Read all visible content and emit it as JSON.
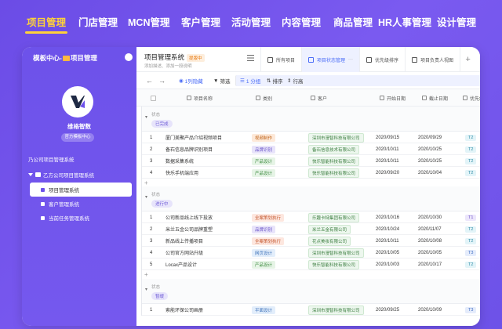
{
  "topnav": {
    "items": [
      "项目管理",
      "门店管理",
      "MCN管理",
      "客户管理",
      "活动管理",
      "内容管理",
      "商品管理",
      "HR人事管理",
      "设计管理"
    ],
    "active_index": 0,
    "active_color": "#ffd23a"
  },
  "left": {
    "title_prefix": "模板中心-",
    "title_suffix": "项目管理",
    "brand_name": "维格智数",
    "brand_sub": "官方模板中心",
    "tree_root": "乃公司项目管理系统",
    "tree_node": "乙方公司项目管理系统",
    "leaves": [
      "项目管理系统",
      "客户管理系统",
      "当前任务管理系统"
    ],
    "active_leaf": 0
  },
  "app": {
    "title": "项目管理系统",
    "badge": "提版中",
    "desc": "添加描述、添加一段说明",
    "tabs": [
      {
        "label": "所有项目",
        "active": false
      },
      {
        "label": "项目状态管理",
        "active": true,
        "more": "···"
      },
      {
        "label": "优先级排序",
        "active": false
      },
      {
        "label": "项目负责人视图",
        "active": false
      }
    ],
    "add_tab": "+"
  },
  "toolbar": {
    "undo": "←",
    "redo": "→",
    "hidden": "1列隐藏",
    "filter": "筛选",
    "group": "1 分组",
    "sort": "排序",
    "row_height": "行高"
  },
  "columns": [
    "项目名称",
    "类别",
    "客户",
    "开始日期",
    "截止日期",
    "优先级"
  ],
  "groups": [
    {
      "label": "状态",
      "tag": "已完成",
      "rows": [
        {
          "n": "1",
          "name": "厦门美聚产品介绍视频项目",
          "cat": "视频制作",
          "cat_color": "#fde9d9",
          "cat_text": "#c0651c",
          "cust": "深圳市漫智科技有限公司",
          "start": "2020/09/15",
          "end": "2020/09/29",
          "pri": "T2"
        },
        {
          "n": "2",
          "name": "备石信息品牌识别项目",
          "cat": "品牌识别",
          "cat_color": "#e8e4fa",
          "cat_text": "#6a55c9",
          "cust": "备石信息技术有限公司",
          "start": "2020/10/11",
          "end": "2020/10/25",
          "pri": "T2"
        },
        {
          "n": "3",
          "name": "数据采集系统",
          "cat": "产品设计",
          "cat_color": "#e6f4e6",
          "cat_text": "#3d8a3f",
          "cust": "快乐智能科技有限公司",
          "start": "2020/10/11",
          "end": "2020/10/25",
          "pri": "T2"
        },
        {
          "n": "4",
          "name": "快乐手机端应用",
          "cat": "产品设计",
          "cat_color": "#e6f4e6",
          "cat_text": "#3d8a3f",
          "cust": "快乐智能科技有限公司",
          "start": "2020/09/20",
          "end": "2020/10/04",
          "pri": "T2"
        }
      ]
    },
    {
      "label": "状态",
      "tag": "进行中",
      "rows": [
        {
          "n": "1",
          "name": "公司新品线上线下投放",
          "cat": "全案策划执行",
          "cat_color": "#fde7df",
          "cat_text": "#c4552c",
          "cust": "乐趣卡特集团有限公司",
          "start": "2020/10/16",
          "end": "2020/10/30",
          "pri": "T1"
        },
        {
          "n": "2",
          "name": "米兰五金公司品牌重塑",
          "cat": "品牌识别",
          "cat_color": "#e8e4fa",
          "cat_text": "#6a55c9",
          "cust": "米兰五金有限公司",
          "start": "2020/10/24",
          "end": "2020/11/07",
          "pri": "T2"
        },
        {
          "n": "3",
          "name": "新品线上传播项目",
          "cat": "全案策划执行",
          "cat_color": "#fde7df",
          "cat_text": "#c4552c",
          "cust": "花点美妆有限公司",
          "start": "2020/10/11",
          "end": "2020/10/08",
          "pri": "T2"
        },
        {
          "n": "4",
          "name": "公司官方网站升级",
          "cat": "网页设计",
          "cat_color": "#e3eefb",
          "cat_text": "#3a6fb8",
          "cust": "深圳市漫智科技有限公司",
          "start": "2020/10/05",
          "end": "2020/10/05",
          "pri": "T3"
        },
        {
          "n": "5",
          "name": "Locax产品设计",
          "cat": "产品设计",
          "cat_color": "#e6f4e6",
          "cat_text": "#3d8a3f",
          "cust": "快乐智能科技有限公司",
          "start": "2020/10/03",
          "end": "2020/10/17",
          "pri": "T2"
        }
      ]
    },
    {
      "label": "状态",
      "tag": "暂缓",
      "rows": [
        {
          "n": "1",
          "name": "索能环保公司画册",
          "cat": "平面设计",
          "cat_color": "#e3eefb",
          "cat_text": "#3a6fb8",
          "cust": "深圳市漫智科技有限公司",
          "start": "2020/09/25",
          "end": "2020/10/09",
          "pri": "T3"
        }
      ]
    }
  ]
}
